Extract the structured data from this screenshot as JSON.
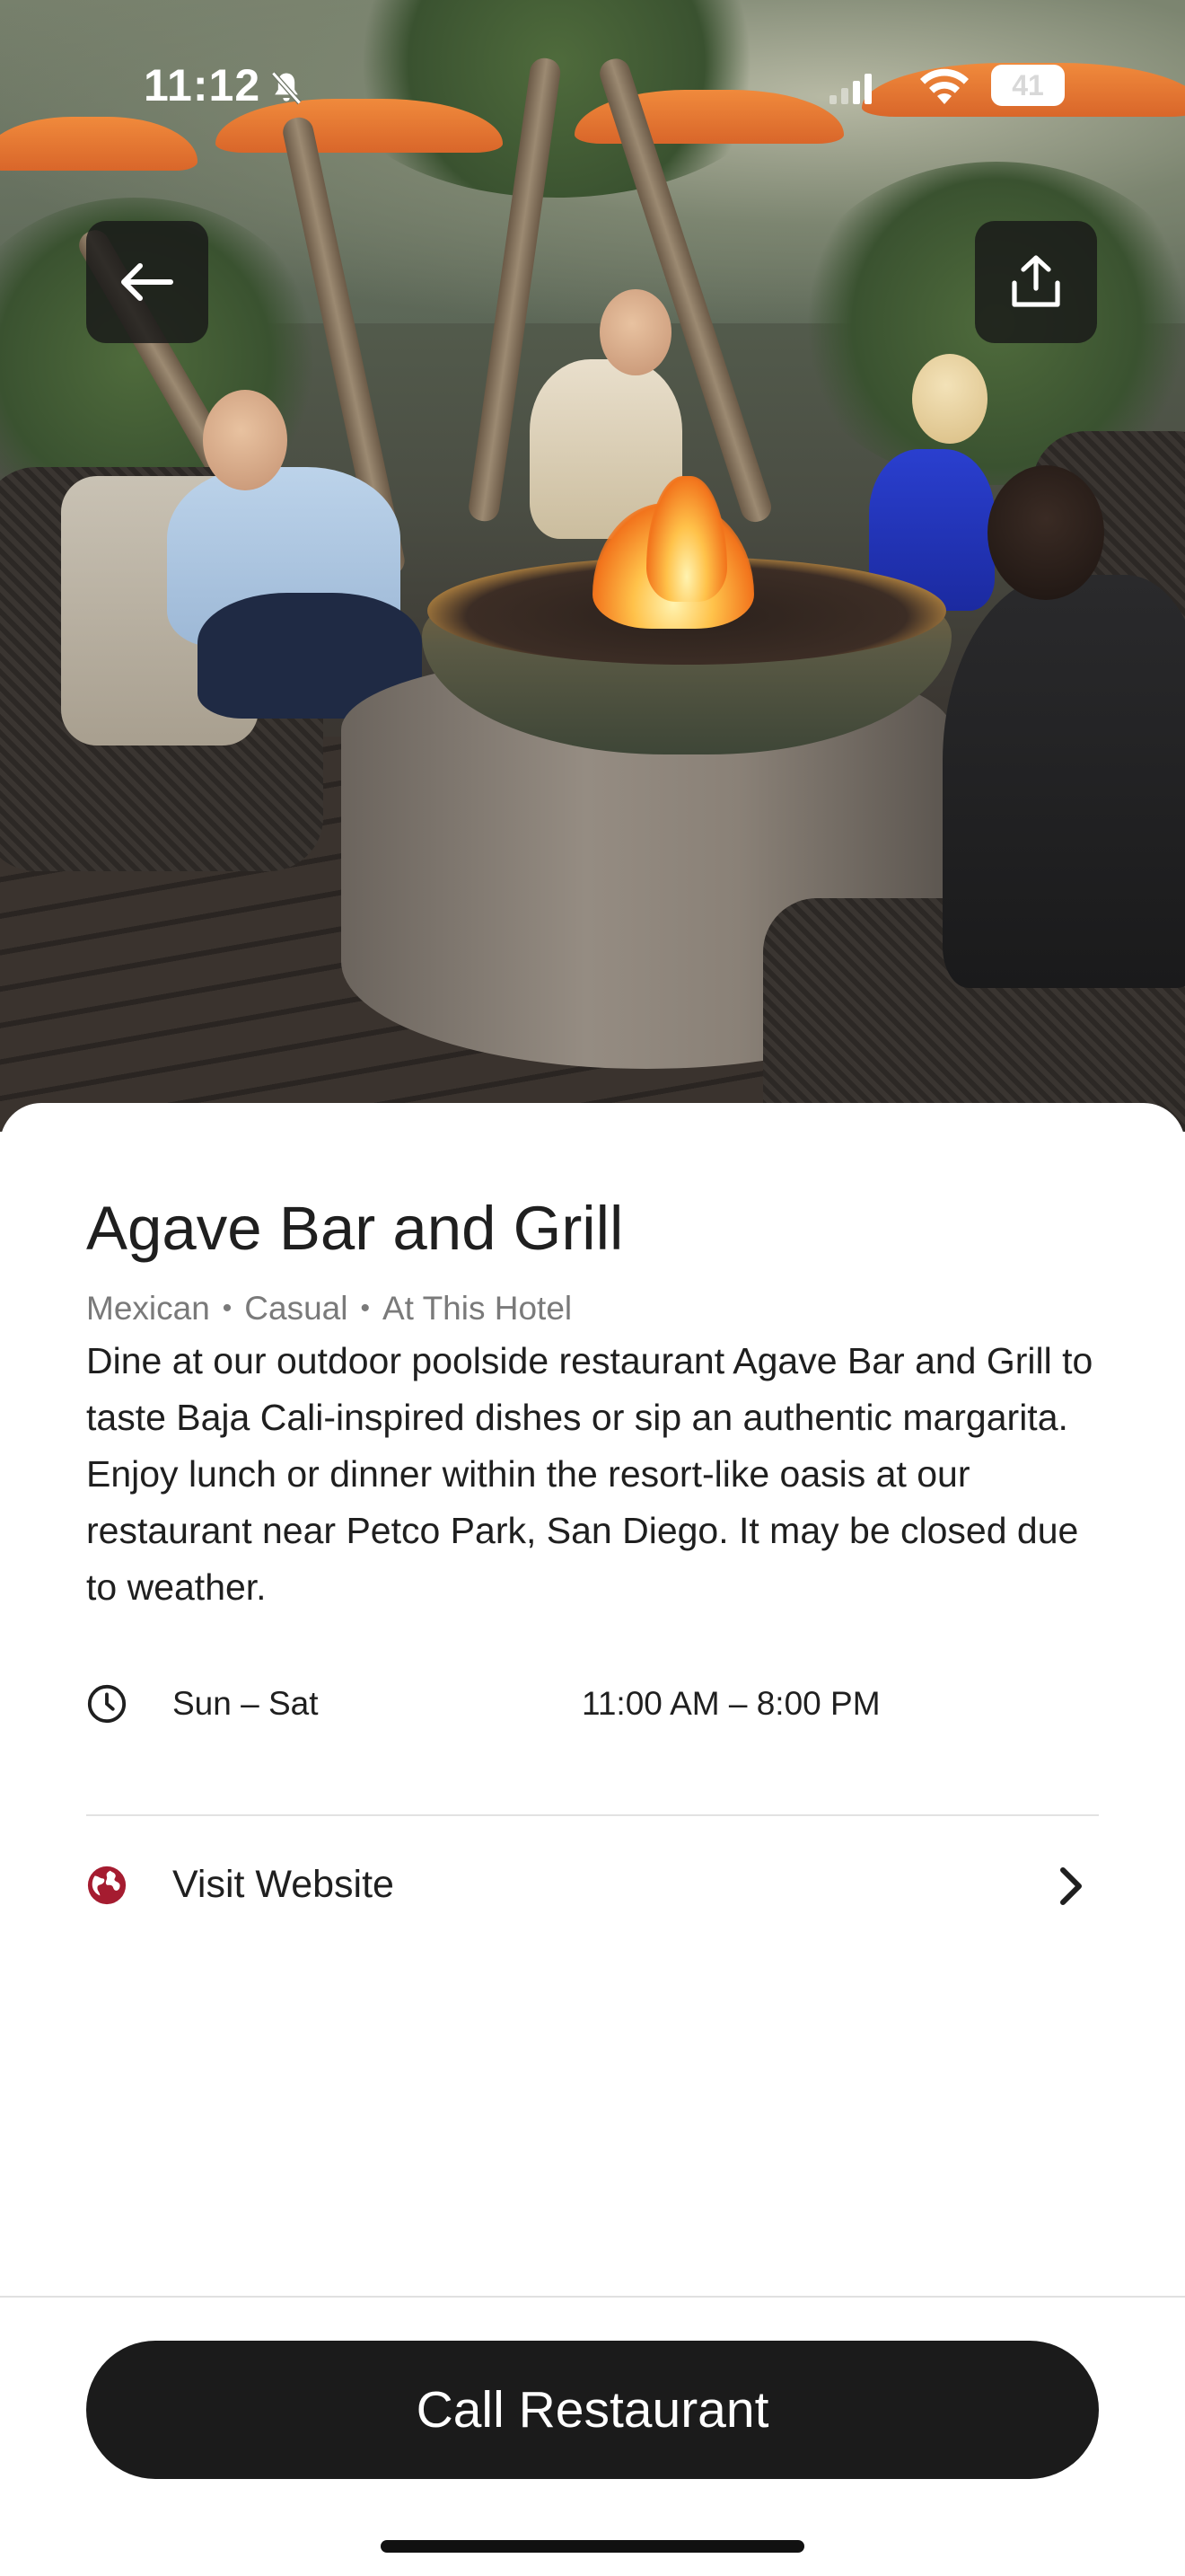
{
  "status_bar": {
    "time": "11:12",
    "battery": "41",
    "icons": [
      "bell-muted-icon",
      "cellular-signal-icon",
      "wifi-icon",
      "battery-icon"
    ]
  },
  "hero": {
    "image": "restaurant-patio-fire-pit-photo"
  },
  "nav": {
    "back_icon": "arrow-left-icon",
    "share_icon": "share-upload-icon"
  },
  "restaurant": {
    "name": "Agave Bar and Grill",
    "tags": [
      "Mexican",
      "Casual",
      "At This Hotel"
    ],
    "description": "Dine at our outdoor poolside restaurant Agave Bar and Grill to taste Baja Cali-inspired dishes or sip an authentic margarita. Enjoy lunch or dinner within the resort-like oasis at our restaurant near Petco Park, San Diego. It may be closed due to weather.",
    "hours": {
      "icon": "clock-icon",
      "days": "Sun – Sat",
      "times": "11:00 AM – 8:00 PM"
    },
    "website": {
      "icon": "globe-icon",
      "label": "Visit Website",
      "chevron_icon": "chevron-right-icon"
    }
  },
  "actions": {
    "call_label": "Call Restaurant"
  },
  "colors": {
    "accent": "#a51c30",
    "button_bg": "#1b1b1b",
    "text_primary": "#1f1f1f",
    "text_secondary": "#7a7a7a"
  }
}
